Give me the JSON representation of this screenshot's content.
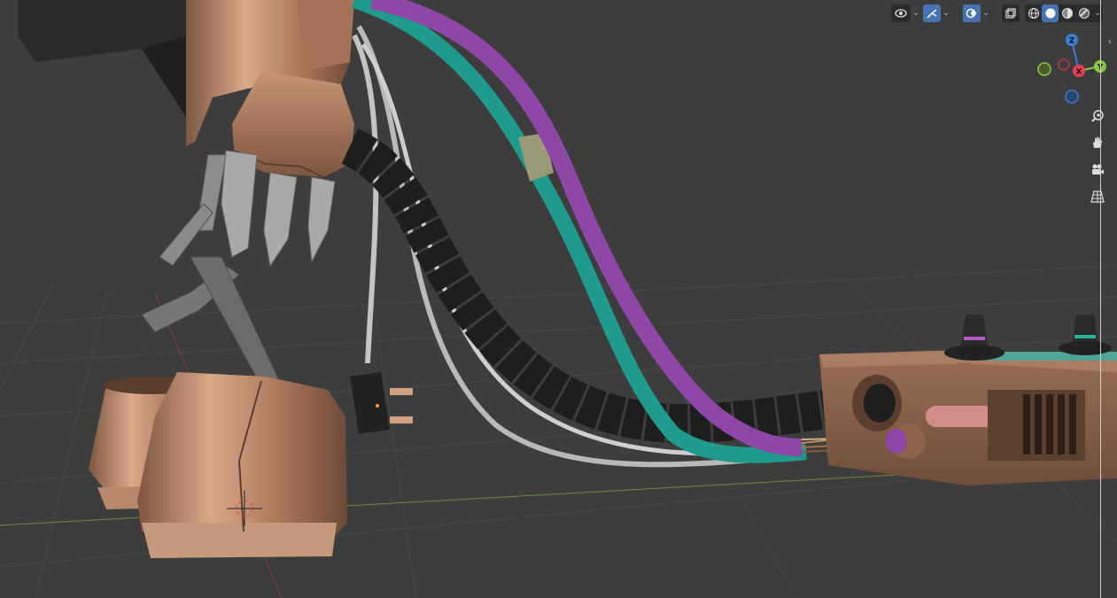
{
  "app": {
    "name": "3D Viewport"
  },
  "header_tools": {
    "visibility_icon": "eye-icon",
    "gizmo_icon": "gizmo-icon",
    "overlays_icon": "overlays-icon",
    "xray_icon": "xray-icon",
    "shading_modes": [
      "wireframe",
      "solid",
      "material-preview",
      "rendered"
    ],
    "active_shading": "solid"
  },
  "navigation_gizmo": {
    "axes": {
      "z": "Z",
      "x": "X",
      "y": "Y"
    },
    "colors": {
      "x": "#e84057",
      "y": "#8cc63e",
      "z": "#3b7fd4"
    }
  },
  "navigation_buttons": [
    {
      "name": "zoom",
      "icon": "zoom-icon"
    },
    {
      "name": "pan",
      "icon": "hand-icon"
    },
    {
      "name": "camera",
      "icon": "camera-icon"
    },
    {
      "name": "perspective",
      "icon": "grid-icon"
    }
  ],
  "scene_colors": {
    "background": "#3d3d3d",
    "grid": "#4a4a4a",
    "copper": "#b07e61",
    "purple_cable": "#8e47a6",
    "teal_cable": "#1f9a8c",
    "black_conduit": "#1e1e1e",
    "white_cable": "#c4c4c4"
  }
}
